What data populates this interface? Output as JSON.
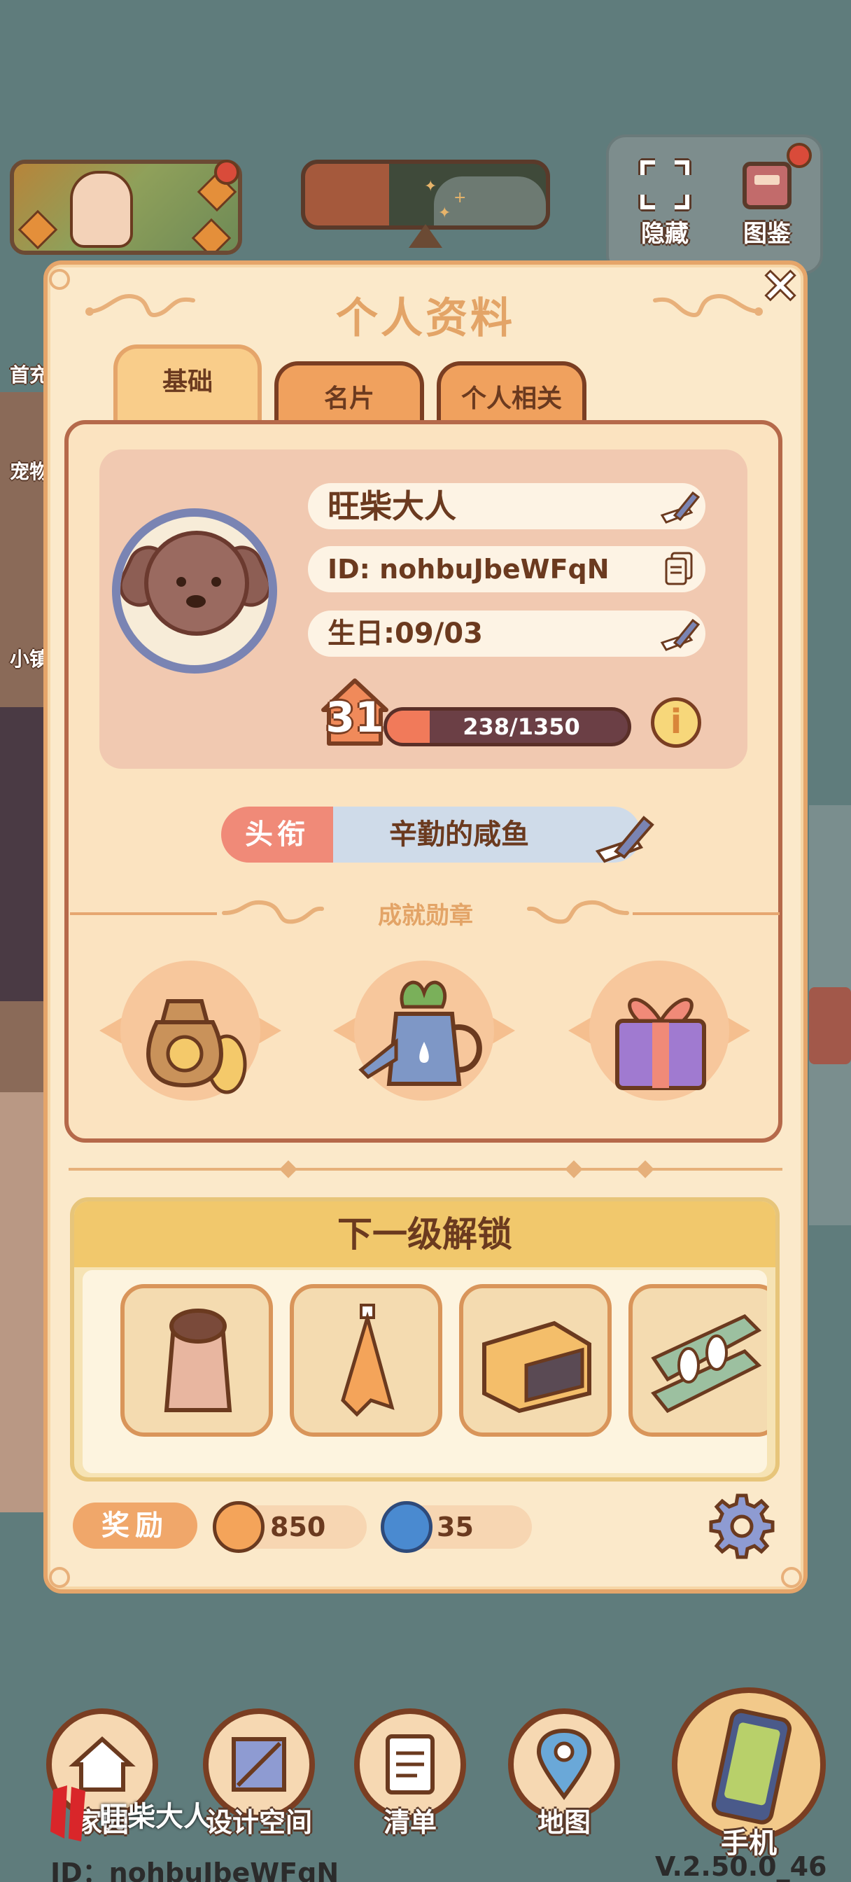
{
  "hud": {
    "hide_label": "隐藏",
    "album_label": "图鉴"
  },
  "side_labels": [
    "首充",
    "宠物",
    "小镇"
  ],
  "panel": {
    "title": "个人资料",
    "tabs": [
      {
        "label": "基础",
        "active": true
      },
      {
        "label": "名片",
        "active": false
      },
      {
        "label": "个人相关",
        "active": false
      }
    ],
    "profile": {
      "name": "旺柴大人",
      "id_text": "ID: nohbuJbeWFqN",
      "birthday_text": "生日:09/03",
      "level": "31",
      "xp_text": "238/1350",
      "xp_progress": 0.176
    },
    "title_tag": {
      "label": "头衔",
      "value": "辛勤的咸鱼"
    },
    "achievements": {
      "heading": "成就勋章",
      "medals": [
        "money-bag-medal-icon",
        "watering-can-medal-icon",
        "gift-box-medal-icon"
      ]
    },
    "unlock": {
      "heading": "下一级解锁",
      "items": [
        "salt-shaker-icon",
        "hanging-towel-icon",
        "oven-icon",
        "plate-rack-icon"
      ]
    },
    "rewards": {
      "label": "奖励",
      "coins": "850",
      "gems": "35"
    }
  },
  "bottom_nav": [
    {
      "label": "家园",
      "icon": "house-icon"
    },
    {
      "label": "设计空间",
      "icon": "blueprint-icon"
    },
    {
      "label": "清单",
      "icon": "checklist-icon"
    },
    {
      "label": "地图",
      "icon": "map-pin-icon"
    }
  ],
  "phone_label": "手机",
  "watermark_name": "旺柴大人",
  "footer": {
    "id_text": "ID：nohbuJbeWFqN",
    "version": "V.2.50.0_46"
  },
  "colors": {
    "panel_bg": "#fbe9ca",
    "panel_border": "#e5a56a",
    "accent_title": "#e3a467",
    "text_brown": "#6b3a1f",
    "xp_fill": "#f17a5a",
    "title_label": "#f08a78",
    "title_value": "#cfdbe9"
  }
}
